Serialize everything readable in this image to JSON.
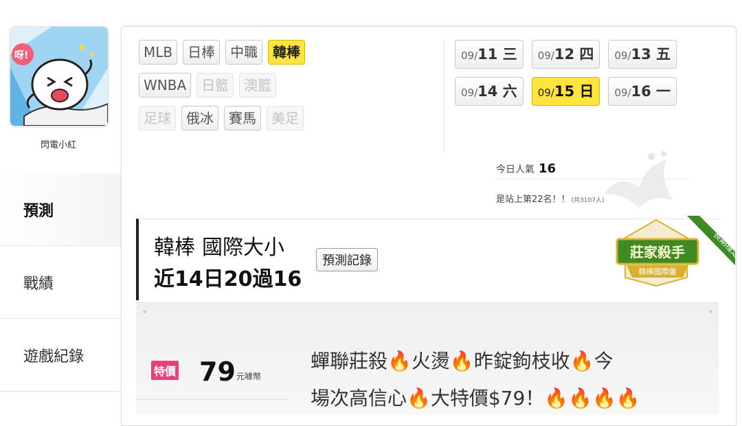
{
  "user": {
    "name": "閃電小紅"
  },
  "sidebar": {
    "items": [
      {
        "label": "預測",
        "active": true
      },
      {
        "label": "戰績",
        "active": false
      },
      {
        "label": "遊戲紀錄",
        "active": false
      }
    ]
  },
  "sports": {
    "row1": [
      {
        "label": "MLB",
        "state": "normal"
      },
      {
        "label": "日棒",
        "state": "normal"
      },
      {
        "label": "中職",
        "state": "normal"
      },
      {
        "label": "韓棒",
        "state": "active"
      }
    ],
    "row2": [
      {
        "label": "WNBA",
        "state": "normal"
      },
      {
        "label": "日籃",
        "state": "disabled"
      },
      {
        "label": "澳籃",
        "state": "disabled"
      }
    ],
    "row3": [
      {
        "label": "足球",
        "state": "disabled"
      },
      {
        "label": "俄冰",
        "state": "normal"
      },
      {
        "label": "賽馬",
        "state": "normal"
      },
      {
        "label": "美足",
        "state": "disabled"
      }
    ]
  },
  "dates": {
    "row1": [
      {
        "md": "09/",
        "day": "11 三"
      },
      {
        "md": "09/",
        "day": "12 四"
      },
      {
        "md": "09/",
        "day": "13 五"
      }
    ],
    "row2": [
      {
        "md": "09/",
        "day": "14 六"
      },
      {
        "md": "09/",
        "day": "15 日",
        "active": true
      },
      {
        "md": "09/",
        "day": "16 一"
      }
    ]
  },
  "popularity": {
    "today_label": "今日人氣",
    "today_value": "16",
    "rank_text": "是站上第22名！！",
    "total_text": "(共3107人)"
  },
  "prediction": {
    "league": "韓棒",
    "market": "國際大小",
    "record": "近14日20過16",
    "record_button": "預測記錄"
  },
  "badge": {
    "title": "莊家殺手",
    "subtitle": "韓棒國際盤",
    "ribbon": "長期穩定"
  },
  "price": {
    "tag": "特價",
    "value": "79",
    "unit": "元噱幣"
  },
  "description": {
    "line1": "蟬聯莊殺🔥火燙🔥昨錠鉤枝收🔥今",
    "line2": "場次高信心🔥大特價$79！🔥🔥🔥🔥"
  },
  "colors": {
    "active_chip": "#ffe43d",
    "price_tag": "#e8407a",
    "badge_green": "#3e8a25",
    "badge_gold": "#d8b22c"
  }
}
